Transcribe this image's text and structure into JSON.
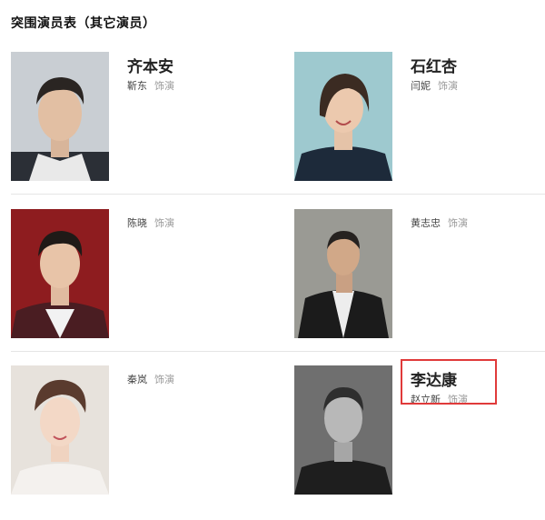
{
  "section": {
    "title": "突围演员表（其它演员）"
  },
  "cast": [
    {
      "role": "齐本安",
      "actor": "靳东",
      "play_label": "饰演"
    },
    {
      "role": "石红杏",
      "actor": "闫妮",
      "play_label": "饰演"
    },
    {
      "role": "",
      "actor": "陈晓",
      "play_label": "饰演"
    },
    {
      "role": "",
      "actor": "黄志忠",
      "play_label": "饰演"
    },
    {
      "role": "",
      "actor": "秦岚",
      "play_label": "饰演"
    },
    {
      "role": "李达康",
      "actor": "赵立新",
      "play_label": "饰演"
    }
  ]
}
